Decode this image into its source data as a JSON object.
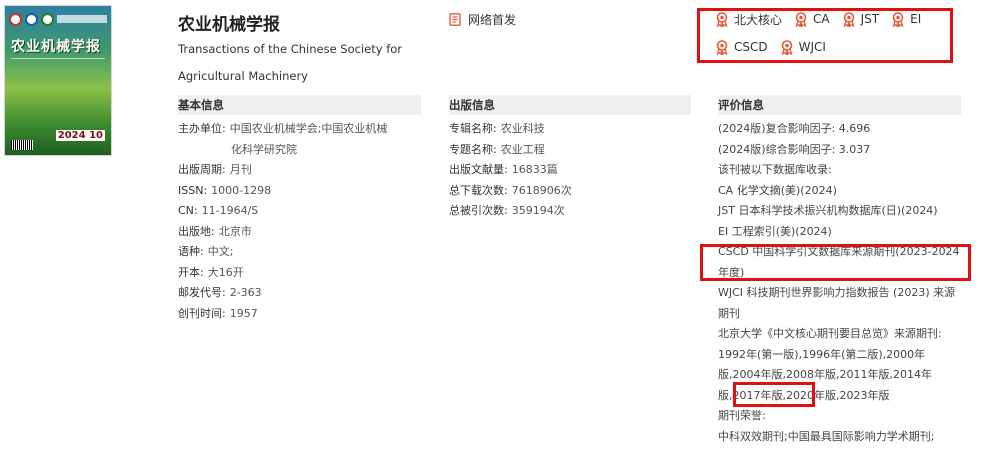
{
  "journal": {
    "title": "农业机械学报",
    "title_en": "Transactions of the Chinese Society for Agricultural Machinery",
    "cover": {
      "title": "农业机械学报",
      "issue": "2024 10"
    },
    "online_first": "网络首发"
  },
  "badges": [
    "北大核心",
    "CA",
    "JST",
    "EI",
    "CSCD",
    "WJCI"
  ],
  "basic": {
    "heading": "基本信息",
    "items": [
      {
        "k": "主办单位:",
        "v": "中国农业机械学会;中国农业机械",
        "v2": "化科学研究院"
      },
      {
        "k": "出版周期:",
        "v": "月刊"
      },
      {
        "k": "ISSN:",
        "v": "1000-1298"
      },
      {
        "k": "CN:",
        "v": "11-1964/S"
      },
      {
        "k": "出版地:",
        "v": "北京市"
      },
      {
        "k": "语种:",
        "v": "中文;"
      },
      {
        "k": "开本:",
        "v": "大16开"
      },
      {
        "k": "邮发代号:",
        "v": "2-363"
      },
      {
        "k": "创刊时间:",
        "v": "1957"
      }
    ]
  },
  "publish": {
    "heading": "出版信息",
    "items": [
      {
        "k": "专辑名称:",
        "v": "农业科技"
      },
      {
        "k": "专题名称:",
        "v": "农业工程"
      },
      {
        "k": "出版文献量:",
        "v": "16833篇"
      },
      {
        "k": "总下载次数:",
        "v": "7618906次"
      },
      {
        "k": "总被引次数:",
        "v": "359194次"
      }
    ]
  },
  "evaluation": {
    "heading": "评价信息",
    "items": [
      "(2024版)复合影响因子: 4.696",
      "(2024版)综合影响因子: 3.037",
      "该刊被以下数据库收录:",
      "CA 化学文摘(美)(2024)",
      "JST 日本科学技术振兴机构数据库(日)(2024)",
      "EI 工程索引(美)(2024)",
      "CSCD 中国科学引文数据库来源期刊(2023-2024年度)",
      "WJCI 科技期刊世界影响力指数报告 (2023) 来源期刊",
      "北京大学《中文核心期刊要目总览》来源期刊:",
      "1992年(第一版),1996年(第二版),2000年版,2004年版,2008年版,2011年版,2014年版,2017年版,2020年版,2023年版",
      "期刊荣誉:",
      "中科双效期刊;中国最具国际影响力学术期刊;"
    ]
  },
  "colors": {
    "accent": "#e8593c",
    "highlight": "#e01010"
  }
}
